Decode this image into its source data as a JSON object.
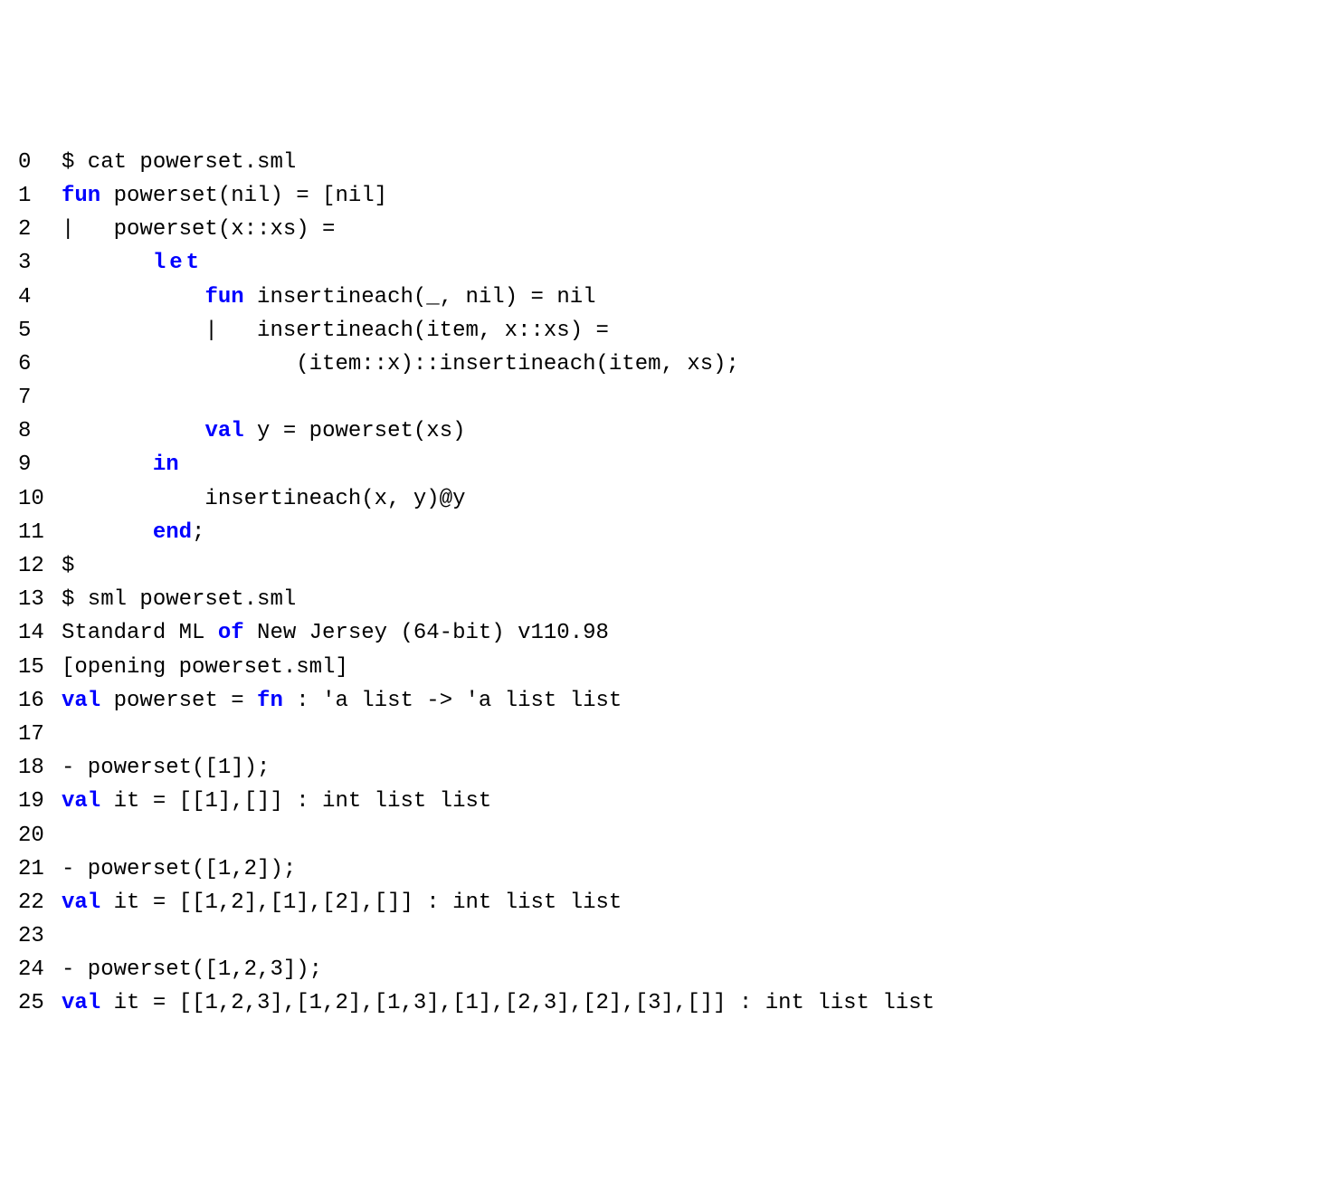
{
  "lines": [
    {
      "no": "0",
      "segs": [
        {
          "t": "$ cat powerset.sml"
        }
      ]
    },
    {
      "no": "1",
      "segs": [
        {
          "t": "fun",
          "c": "kw"
        },
        {
          "t": " powerset(nil) = [nil]"
        }
      ]
    },
    {
      "no": "2",
      "segs": [
        {
          "t": "|   powerset(x::xs) ="
        }
      ]
    },
    {
      "no": "3",
      "segs": [
        {
          "t": "       "
        },
        {
          "t": "let",
          "c": "kw-ns"
        }
      ]
    },
    {
      "no": "4",
      "segs": [
        {
          "t": "           "
        },
        {
          "t": "fun",
          "c": "kw"
        },
        {
          "t": " insertineach(_, nil) = nil"
        }
      ]
    },
    {
      "no": "5",
      "segs": [
        {
          "t": "           |   insertineach(item, x::xs) ="
        }
      ]
    },
    {
      "no": "6",
      "segs": [
        {
          "t": "                  (item::x)::insertineach(item, xs);"
        }
      ]
    },
    {
      "no": "7",
      "segs": [
        {
          "t": ""
        }
      ]
    },
    {
      "no": "8",
      "segs": [
        {
          "t": "           "
        },
        {
          "t": "val",
          "c": "kw"
        },
        {
          "t": " y = powerset(xs)"
        }
      ]
    },
    {
      "no": "9",
      "segs": [
        {
          "t": "       "
        },
        {
          "t": "in",
          "c": "kw"
        }
      ]
    },
    {
      "no": "10",
      "segs": [
        {
          "t": "           insertineach(x, y)@y"
        }
      ]
    },
    {
      "no": "11",
      "segs": [
        {
          "t": "       "
        },
        {
          "t": "end",
          "c": "kw"
        },
        {
          "t": ";"
        }
      ]
    },
    {
      "no": "12",
      "segs": [
        {
          "t": "$"
        }
      ]
    },
    {
      "no": "13",
      "segs": [
        {
          "t": "$ sml powerset.sml"
        }
      ]
    },
    {
      "no": "14",
      "segs": [
        {
          "t": "Standard ML "
        },
        {
          "t": "of",
          "c": "kw"
        },
        {
          "t": " New Jersey (64-bit) v110.98"
        }
      ]
    },
    {
      "no": "15",
      "segs": [
        {
          "t": "[opening powerset.sml]"
        }
      ]
    },
    {
      "no": "16",
      "segs": [
        {
          "t": "val",
          "c": "kw"
        },
        {
          "t": " powerset = "
        },
        {
          "t": "fn",
          "c": "kw"
        },
        {
          "t": " : 'a list -> 'a list list"
        }
      ]
    },
    {
      "no": "17",
      "segs": [
        {
          "t": ""
        }
      ]
    },
    {
      "no": "18",
      "segs": [
        {
          "t": "- powerset([1]);"
        }
      ]
    },
    {
      "no": "19",
      "segs": [
        {
          "t": "val",
          "c": "kw"
        },
        {
          "t": " it = [[1],[]] : int list list"
        }
      ]
    },
    {
      "no": "20",
      "segs": [
        {
          "t": ""
        }
      ]
    },
    {
      "no": "21",
      "segs": [
        {
          "t": "- powerset([1,2]);"
        }
      ]
    },
    {
      "no": "22",
      "segs": [
        {
          "t": "val",
          "c": "kw"
        },
        {
          "t": " it = [[1,2],[1],[2],[]] : int list list"
        }
      ]
    },
    {
      "no": "23",
      "segs": [
        {
          "t": ""
        }
      ]
    },
    {
      "no": "24",
      "segs": [
        {
          "t": "- powerset([1,2,3]);"
        }
      ]
    },
    {
      "no": "25",
      "segs": [
        {
          "t": "val",
          "c": "kw"
        },
        {
          "t": " it = [[1,2,3],[1,2],[1,3],[1],[2,3],[2],[3],[]] : int list list"
        }
      ]
    }
  ]
}
